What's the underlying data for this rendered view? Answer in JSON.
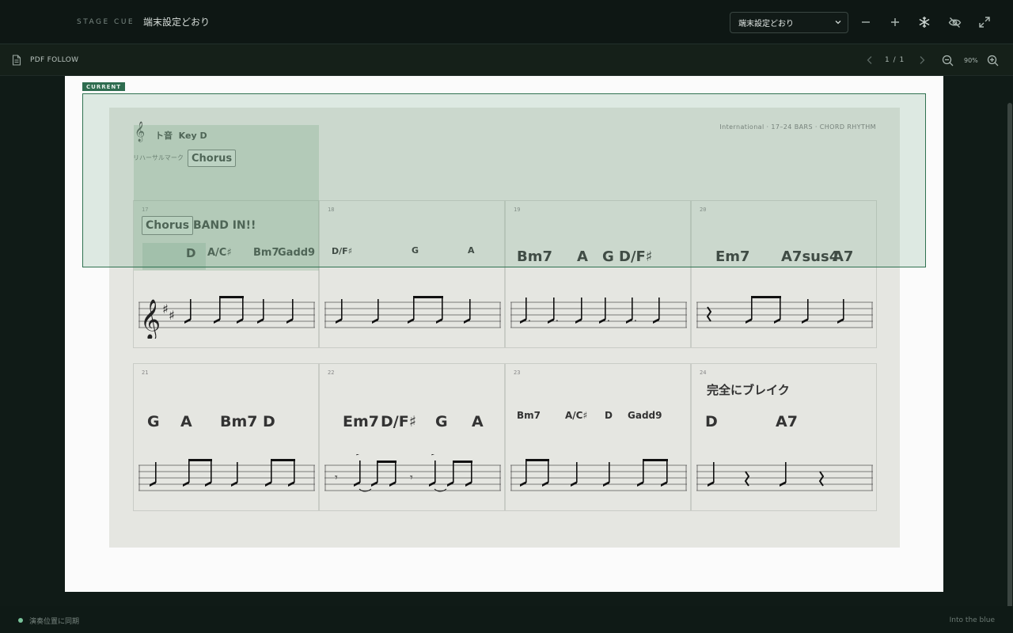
{
  "header": {
    "brand": "STAGE CUE",
    "title": "端末設定どおり",
    "select_value": "端末設定どおり"
  },
  "toolbar": {
    "icons": [
      "minus-icon",
      "plus-icon",
      "snowflake-icon",
      "eye-off-icon",
      "fullscreen-icon"
    ]
  },
  "subbar": {
    "mode_label": "PDF FOLLOW",
    "page_indicator": "1 / 1",
    "zoom": "90%"
  },
  "sheet": {
    "clef_label": "ト音",
    "key_label": "Key D",
    "info": "International · 17–24 BARS · CHORD RHYTHM",
    "rehearsal_label": "リハーサルマーク",
    "rehearsal_value": "Chorus",
    "current_label": "CURRENT",
    "bars": [
      {
        "num": "17",
        "cue_box": "Chorus",
        "cue_text": "BAND IN!!",
        "chords": [
          "D",
          "A/C♯",
          "Bm7",
          "Gadd9"
        ]
      },
      {
        "num": "18",
        "chords": [
          "D/F♯",
          "G",
          "A"
        ]
      },
      {
        "num": "19",
        "chords": [
          "Bm7",
          "A",
          "G",
          "D/F♯"
        ]
      },
      {
        "num": "20",
        "chords": [
          "Em7",
          "A7sus4",
          "A7"
        ]
      },
      {
        "num": "21",
        "chords": [
          "G",
          "A",
          "Bm7",
          "D"
        ]
      },
      {
        "num": "22",
        "chords": [
          "Em7",
          "D/F♯",
          "G",
          "A"
        ]
      },
      {
        "num": "23",
        "chords": [
          "Bm7",
          "A/C♯",
          "D",
          "Gadd9"
        ]
      },
      {
        "num": "24",
        "cue_text": "完全にブレイク",
        "chords": [
          "D",
          "A7"
        ]
      }
    ]
  },
  "footer": {
    "sync_label": "演奏位置に同期",
    "song_title": "Into the blue"
  },
  "colors": {
    "accent": "#2e6c4f",
    "background": "#0f1a16",
    "paper": "#fbfbfb"
  }
}
